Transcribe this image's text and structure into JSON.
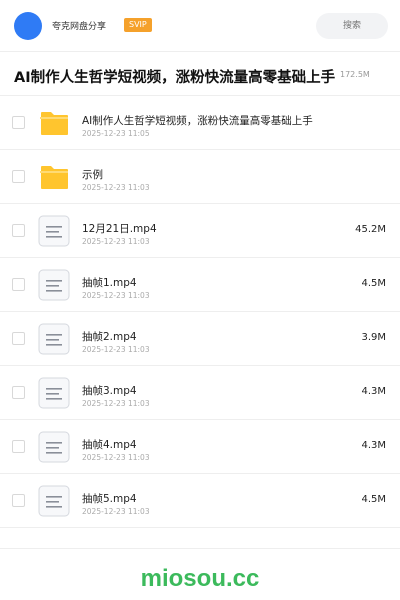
{
  "header": {
    "app_name": "夸克网盘分享",
    "badge": "SVIP",
    "search_placeholder": "搜索"
  },
  "share": {
    "title": "AI制作人生哲学短视频，涨粉快流量高零基础上手",
    "total_size": "172.5M"
  },
  "files": [
    {
      "type": "folder",
      "name": "AI制作人生哲学短视频，涨粉快流量高零基础上手",
      "date": "2025-12-23 11:05",
      "size": ""
    },
    {
      "type": "folder",
      "name": "示例",
      "date": "2025-12-23 11:03",
      "size": ""
    },
    {
      "type": "video",
      "name": "12月21日.mp4",
      "date": "2025-12-23 11:03",
      "size": "45.2M"
    },
    {
      "type": "video",
      "name": "抽帧1.mp4",
      "date": "2025-12-23 11:03",
      "size": "4.5M"
    },
    {
      "type": "video",
      "name": "抽帧2.mp4",
      "date": "2025-12-23 11:03",
      "size": "3.9M"
    },
    {
      "type": "video",
      "name": "抽帧3.mp4",
      "date": "2025-12-23 11:03",
      "size": "4.3M"
    },
    {
      "type": "video",
      "name": "抽帧4.mp4",
      "date": "2025-12-23 11:03",
      "size": "4.3M"
    },
    {
      "type": "video",
      "name": "抽帧5.mp4",
      "date": "2025-12-23 11:03",
      "size": "4.5M"
    }
  ],
  "watermark": "miosou.cc",
  "colors": {
    "accent": "#2f7bf5",
    "svip": "#f5a12b",
    "folder": "#ffc52e",
    "watermark": "#3cba5c"
  }
}
